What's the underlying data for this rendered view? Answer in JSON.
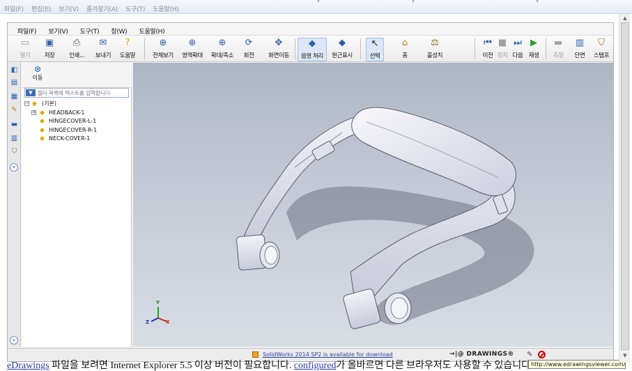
{
  "browser_menu": [
    "파일(F)",
    "편집(E)",
    "보기(V)",
    "즐겨찾기(A)",
    "도구(T)",
    "도움말(H)"
  ],
  "app_menu": [
    "파일(F)",
    "보기(V)",
    "도구(T)",
    "창(W)",
    "도움말(H)"
  ],
  "toolbar": {
    "open": "열기",
    "save": "저장",
    "print": "인쇄...",
    "send": "보내기",
    "help": "도움말",
    "zoom_fit": "전체보기",
    "zoom_area": "영역확대",
    "zoom_inout": "확대/축소",
    "rotate": "회전",
    "pan": "화면이동",
    "shaded": "음영 처리",
    "perspective": "원근표시",
    "select": "선택",
    "home": "홈",
    "interference": "흘성치",
    "previous": "이전",
    "stop": "정지",
    "next": "다음",
    "play": "재생",
    "measure": "측정",
    "section": "단면",
    "stamp": "스탬프"
  },
  "panel": {
    "move_label": "이동",
    "filter_placeholder": "필터 목록에 텍스트를 입력합니다.",
    "tree": {
      "root": "(기본)",
      "children": [
        "HEADBACK-1",
        "HINGECOVER-L-1",
        "HINGECOVER-R-1",
        "NECK-COVER-1"
      ]
    }
  },
  "triad": {
    "x": "X",
    "y": "Y",
    "z": "Z"
  },
  "status": {
    "download_text": "SolidWorks 2014 SP2 is available for download",
    "logo": "→|@ DRAWINGS®"
  },
  "page_text": {
    "link1": "eDrawings",
    "part1": " 파일을 보려면 ",
    "ie": "Internet Explorer 5.5",
    "part2": " 이상 버전이 필요합니다. ",
    "link2": "configured",
    "part3": "가 올바르면 다른 브라우저도 사용할 수 있습니다."
  },
  "tooltip": "http://www.edrawingsviewer.com/",
  "colors": {
    "accent": "#2f5fa8",
    "viewport_top": "#aeb6c4",
    "viewport_bottom": "#d8dde4",
    "model": "#e4e6f0"
  }
}
